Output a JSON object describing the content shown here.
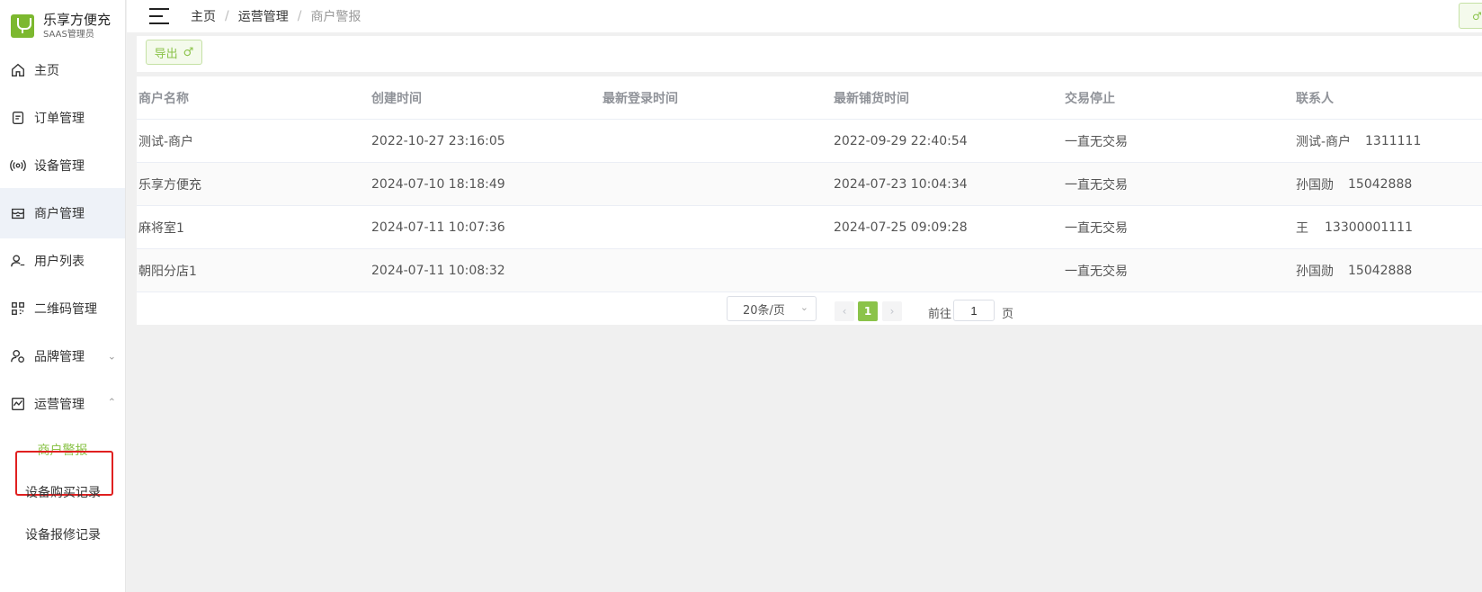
{
  "app": {
    "title": "乐享方便充",
    "subtitle": "SAAS管理员"
  },
  "sidebar": {
    "items": [
      {
        "label": "主页",
        "icon": "home-icon"
      },
      {
        "label": "订单管理",
        "icon": "order-icon"
      },
      {
        "label": "设备管理",
        "icon": "device-icon"
      },
      {
        "label": "商户管理",
        "icon": "merchant-icon"
      },
      {
        "label": "用户列表",
        "icon": "user-icon"
      },
      {
        "label": "二维码管理",
        "icon": "qrcode-icon"
      },
      {
        "label": "品牌管理",
        "icon": "brand-icon"
      },
      {
        "label": "运营管理",
        "icon": "operation-icon"
      }
    ],
    "sub_items": [
      {
        "label": "商户警报"
      },
      {
        "label": "设备购买记录"
      },
      {
        "label": "设备报修记录"
      }
    ]
  },
  "breadcrumb": [
    "主页",
    "运营管理",
    "商户警报"
  ],
  "breadcrumb_sep": "/",
  "toolbar": {
    "export_label": "导出",
    "export_icon": "♂",
    "top_right_icon": "♂"
  },
  "table": {
    "columns": [
      "商户名称",
      "创建时间",
      "最新登录时间",
      "最新铺货时间",
      "交易停止",
      "联系人"
    ],
    "rows": [
      {
        "name": "测试-商户",
        "created": "2022-10-27 23:16:05",
        "last_login": "",
        "last_deploy": "2022-09-29 22:40:54",
        "stop": "一直无交易",
        "contact": "测试-商户",
        "phone": "1311111"
      },
      {
        "name": "乐享方便充",
        "created": "2024-07-10 18:18:49",
        "last_login": "",
        "last_deploy": "2024-07-23 10:04:34",
        "stop": "一直无交易",
        "contact": "孙国勋",
        "phone": "15042888"
      },
      {
        "name": "麻将室1",
        "created": "2024-07-11 10:07:36",
        "last_login": "",
        "last_deploy": "2024-07-25 09:09:28",
        "stop": "一直无交易",
        "contact": "王",
        "phone": "13300001111"
      },
      {
        "name": "朝阳分店1",
        "created": "2024-07-11 10:08:32",
        "last_login": "",
        "last_deploy": "",
        "stop": "一直无交易",
        "contact": "孙国勋",
        "phone": "15042888"
      }
    ]
  },
  "pagination": {
    "page_size_label": "20条/页",
    "current_page": "1",
    "goto_prefix": "前往",
    "goto_value": "1",
    "goto_suffix": "页",
    "prev_icon": "‹",
    "next_icon": "›"
  },
  "colors": {
    "accent": "#8bc34a",
    "highlight_border": "#e02020",
    "active_nav_bg": "#eef2f8"
  }
}
